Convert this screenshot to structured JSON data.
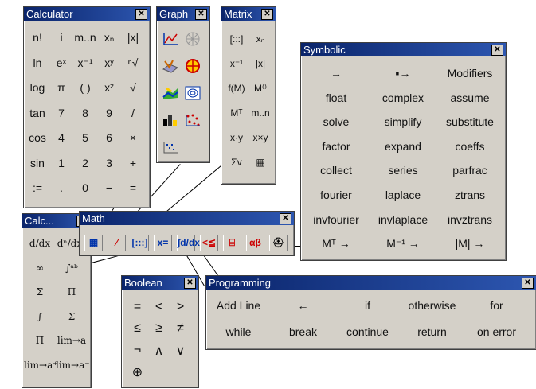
{
  "calculator": {
    "title": "Calculator",
    "rows": [
      [
        "n!",
        "i",
        "m..n",
        "xₙ",
        "|x|"
      ],
      [
        "ln",
        "eˣ",
        "x⁻¹",
        "xʸ",
        "ⁿ√"
      ],
      [
        "log",
        "π",
        "( )",
        "x²",
        "√"
      ],
      [
        "tan",
        "7",
        "8",
        "9",
        "/"
      ],
      [
        "cos",
        "4",
        "5",
        "6",
        "×"
      ],
      [
        "sin",
        "1",
        "2",
        "3",
        "+"
      ],
      [
        ":=",
        ".",
        "0",
        "−",
        "="
      ]
    ]
  },
  "graph": {
    "title": "Graph",
    "icons": [
      "xy-plot-icon",
      "polar-plot-icon",
      "surface-plot-icon",
      "contour-plot-icon",
      "3d-scatter-icon",
      "vector-field-icon",
      "3d-bar-icon",
      "3d-plot-wizard-icon",
      "zoom-icon"
    ]
  },
  "matrix": {
    "title": "Matrix",
    "rows": [
      [
        "[:::]",
        "xₙ"
      ],
      [
        "x⁻¹",
        "|x|"
      ],
      [
        "f(M)",
        "M⁽⁾"
      ],
      [
        "Mᵀ",
        "m..n"
      ],
      [
        "x·y",
        "x×y"
      ],
      [
        "Σv",
        "▦"
      ]
    ]
  },
  "symbolic": {
    "title": "Symbolic",
    "rows": [
      [
        "→",
        "▪→",
        "Modifiers"
      ],
      [
        "float",
        "complex",
        "assume"
      ],
      [
        "solve",
        "simplify",
        "substitute"
      ],
      [
        "factor",
        "expand",
        "coeffs"
      ],
      [
        "collect",
        "series",
        "parfrac"
      ],
      [
        "fourier",
        "laplace",
        "ztrans"
      ],
      [
        "invfourier",
        "invlaplace",
        "invztrans"
      ],
      [
        "Mᵀ →",
        "M⁻¹ →",
        "|M| →"
      ]
    ]
  },
  "calculus": {
    "title": "Calc...",
    "rows": [
      [
        "d/dx",
        "dⁿ/dxⁿ"
      ],
      [
        "∞",
        "∫ᵃᵇ"
      ],
      [
        "Σ",
        "Π"
      ],
      [
        "∫",
        "Σ"
      ],
      [
        "Π",
        "lim→a"
      ],
      [
        "lim→a⁺",
        "lim→a⁻"
      ]
    ]
  },
  "math": {
    "title": "Math",
    "buttons": [
      "▦",
      "⁄",
      "[:::]",
      "x=",
      "∫d/dx",
      "<≦",
      "⌸",
      "αβ",
      "⛑"
    ]
  },
  "boolean": {
    "title": "Boolean",
    "rows": [
      [
        "=",
        "<",
        ">"
      ],
      [
        "≤",
        "≥",
        "≠"
      ],
      [
        "¬",
        "∧",
        "∨"
      ],
      [
        "⊕",
        "",
        ""
      ]
    ]
  },
  "programming": {
    "title": "Programming",
    "rows": [
      [
        "Add Line",
        "←",
        "if",
        "otherwise",
        "for"
      ],
      [
        "while",
        "break",
        "continue",
        "return",
        "on error"
      ]
    ]
  },
  "colors": {
    "titlebar": "#0a246a",
    "face": "#d4d0c8"
  }
}
